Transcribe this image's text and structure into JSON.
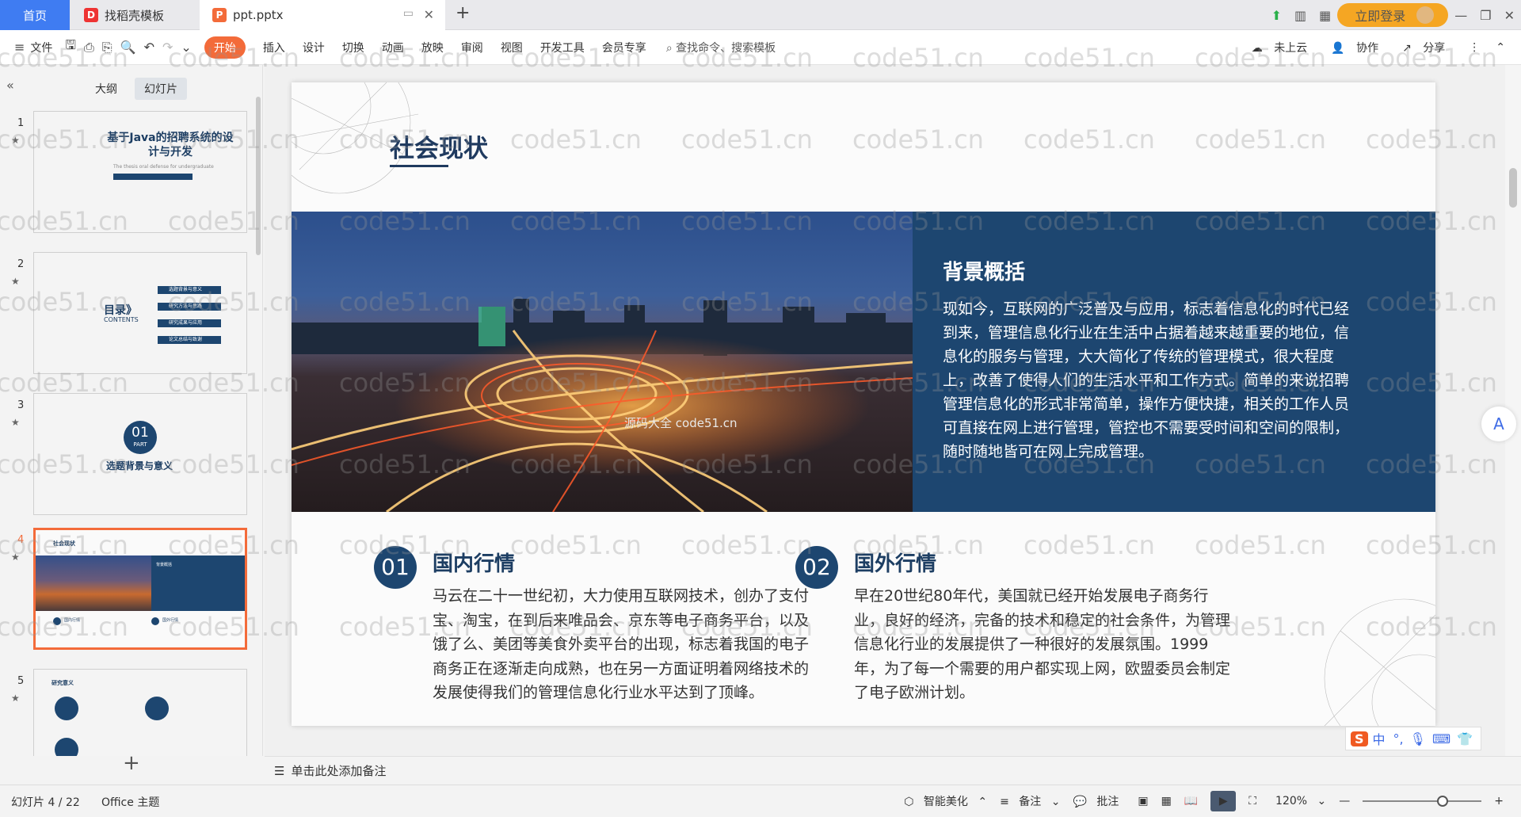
{
  "tabbar": {
    "home": "首页",
    "tab1": "找稻壳模板",
    "tab2": "ppt.pptx",
    "login": "立即登录"
  },
  "ribbon": {
    "file": "文件",
    "tabs": [
      "开始",
      "插入",
      "设计",
      "切换",
      "动画",
      "放映",
      "审阅",
      "视图",
      "开发工具",
      "会员专享"
    ],
    "search": "查找命令、搜索模板",
    "cloud": "未上云",
    "collab": "协作",
    "share": "分享"
  },
  "leftpanel": {
    "tab_outline": "大纲",
    "tab_slides": "幻灯片",
    "slide_numbers": [
      "1",
      "2",
      "3",
      "4",
      "5"
    ],
    "thumb1_title": "基于Java的招聘系统的设计与开发",
    "thumb1_sub": "The thesis oral defense for undergraduate",
    "thumb2_title": "目录》",
    "thumb2_sub": "CONTENTS",
    "thumb2_items": [
      "选题背景与意义",
      "研究方法与思路",
      "研究成果与应用",
      "论文总结与致谢"
    ],
    "thumb3_num": "01",
    "thumb3_part": "PART",
    "thumb3_title": "选题背景与意义",
    "thumb5_title": "研究意义"
  },
  "slide": {
    "title": "社会现状",
    "bg_title": "背景概括",
    "bg_text": "现如今，互联网的广泛普及与应用，标志着信息化的时代已经到来，管理信息化行业在生活中占据着越来越重要的地位，信息化的服务与管理，大大简化了传统的管理模式，很大程度上，改善了使得人们的生活水平和工作方式。简单的来说招聘管理信息化的形式非常简单，操作方便快捷，相关的工作人员可直接在网上进行管理，管控也不需要受时间和空间的限制，随时随地皆可在网上完成管理。",
    "photo_caption": "源码大全 code51.cn",
    "col1_num": "01",
    "col1_title": "国内行情",
    "col1_text": "马云在二十一世纪初，大力使用互联网技术，创办了支付宝、淘宝，在到后来唯品会、京东等电子商务平台，以及饿了么、美团等美食外卖平台的出现，标志着我国的电子商务正在逐渐走向成熟，也在另一方面证明着网络技术的发展使得我们的管理信息化行业水平达到了顶峰。",
    "col2_num": "02",
    "col2_title": "国外行情",
    "col2_text": " 早在20世纪80年代，美国就已经开始发展电子商务行业，良好的经济，完备的技术和稳定的社会条件，为管理信息化行业的发展提供了一种很好的发展氛围。1999年，为了每一个需要的用户都实现上网，欧盟委员会制定了电子欧洲计划。"
  },
  "watermark": "code51.cn",
  "notes": "单击此处添加备注",
  "status": {
    "slide_counter": "幻灯片 4 / 22",
    "theme": "Office 主题",
    "beautify": "智能美化",
    "notes_btn": "备注",
    "comments": "批注",
    "zoom": "120%"
  },
  "colors": {
    "accent": "#f36b3a",
    "slide_blue": "#1d4670",
    "home_tab": "#3f7cf2"
  }
}
